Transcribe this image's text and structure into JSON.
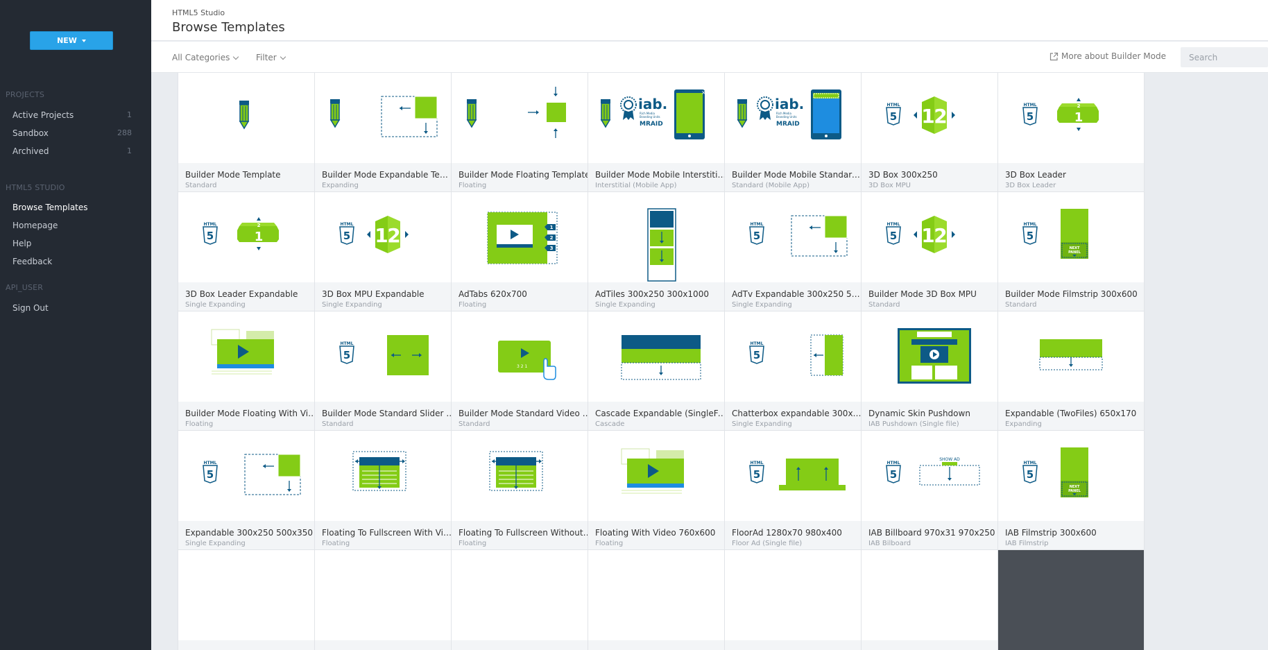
{
  "sidebar": {
    "new_label": "NEW",
    "projects_heading": "PROJECTS",
    "projects": [
      {
        "label": "Active Projects",
        "count": "1"
      },
      {
        "label": "Sandbox",
        "count": "288"
      },
      {
        "label": "Archived",
        "count": "1"
      }
    ],
    "studio_heading": "HTML5 STUDIO",
    "studio_items": [
      "Browse Templates",
      "Homepage",
      "Help",
      "Feedback"
    ],
    "user_heading": "API_USER",
    "sign_out": "Sign Out"
  },
  "header": {
    "breadcrumb": "HTML5 Studio",
    "title": "Browse Templates"
  },
  "filters": {
    "categories": "All Categories",
    "filter": "Filter",
    "more_link": "More about Builder Mode",
    "search_placeholder": "Search"
  },
  "colors": {
    "accent": "#29a3e8",
    "green": "#84cc16",
    "navy": "#0d5a86",
    "sidebar": "#242a33"
  },
  "templates": [
    {
      "title": "Builder Mode Template",
      "subtitle": "Standard",
      "thumb": "pencil"
    },
    {
      "title": "Builder Mode Expandable Templ...",
      "subtitle": "Expanding",
      "thumb": "pencil-expand"
    },
    {
      "title": "Builder Mode Floating Template",
      "subtitle": "Floating",
      "thumb": "pencil-float"
    },
    {
      "title": "Builder Mode Mobile Interstitial...",
      "subtitle": "Interstitial (Mobile App)",
      "thumb": "iab-green",
      "iab": "iab.",
      "mraid": "MRAID"
    },
    {
      "title": "Builder Mode Mobile Standard T...",
      "subtitle": "Standard (Mobile App)",
      "thumb": "iab-blue",
      "iab": "iab.",
      "mraid": "MRAID"
    },
    {
      "title": "3D Box 300x250",
      "subtitle": "3D Box MPU",
      "thumb": "box12"
    },
    {
      "title": "3D Box Leader",
      "subtitle": "3D Box Leader",
      "thumb": "leader"
    },
    {
      "title": "3D Box Leader Expandable",
      "subtitle": "Single Expanding",
      "thumb": "leader"
    },
    {
      "title": "3D Box MPU Expandable",
      "subtitle": "Single Expanding",
      "thumb": "box12"
    },
    {
      "title": "AdTabs 620x700",
      "subtitle": "Floating",
      "thumb": "adtabs"
    },
    {
      "title": "AdTiles 300x250 300x1000",
      "subtitle": "Single Expanding",
      "thumb": "adtiles"
    },
    {
      "title": "AdTv Expandable 300x250 500x...",
      "subtitle": "Single Expanding",
      "thumb": "html5-expand"
    },
    {
      "title": "Builder Mode 3D Box MPU",
      "subtitle": "Standard",
      "thumb": "box12"
    },
    {
      "title": "Builder Mode Filmstrip 300x600",
      "subtitle": "Standard",
      "thumb": "filmstrip",
      "panel": "NEXT PANEL"
    },
    {
      "title": "Builder Mode Floating With Vid...",
      "subtitle": "Floating",
      "thumb": "video-float"
    },
    {
      "title": "Builder Mode Standard Slider 3...",
      "subtitle": "Standard",
      "thumb": "slider"
    },
    {
      "title": "Builder Mode Standard Video M...",
      "subtitle": "Standard",
      "thumb": "video-hand",
      "counter": "3 2 1"
    },
    {
      "title": "Cascade Expandable (SingleFile)...",
      "subtitle": "Cascade",
      "thumb": "cascade"
    },
    {
      "title": "Chatterbox expandable 300x60...",
      "subtitle": "Single Expanding",
      "thumb": "chatterbox"
    },
    {
      "title": "Dynamic Skin Pushdown",
      "subtitle": "IAB Pushdown (Single file)",
      "thumb": "skin"
    },
    {
      "title": "Expandable (TwoFiles) 650x170",
      "subtitle": "Expanding",
      "thumb": "twofiles"
    },
    {
      "title": "Expandable 300x250 500x350",
      "subtitle": "Single Expanding",
      "thumb": "html5-expand"
    },
    {
      "title": "Floating To Fullscreen With Video",
      "subtitle": "Floating",
      "thumb": "fullscreen"
    },
    {
      "title": "Floating To Fullscreen Without ...",
      "subtitle": "Floating",
      "thumb": "fullscreen"
    },
    {
      "title": "Floating With Video 760x600",
      "subtitle": "Floating",
      "thumb": "video-float"
    },
    {
      "title": "FloorAd 1280x70 980x400",
      "subtitle": "Floor Ad (Single file)",
      "thumb": "floorad"
    },
    {
      "title": "IAB Billboard 970x31 970x250",
      "subtitle": "IAB Bilboard",
      "thumb": "billboard",
      "show_ad": "SHOW AD"
    },
    {
      "title": "IAB Filmstrip 300x600",
      "subtitle": "IAB Filmstrip",
      "thumb": "filmstrip",
      "panel": "NEXT PANEL"
    },
    {
      "title": "",
      "subtitle": "",
      "thumb": "blank"
    },
    {
      "title": "",
      "subtitle": "",
      "thumb": "blank"
    },
    {
      "title": "",
      "subtitle": "",
      "thumb": "blank"
    },
    {
      "title": "",
      "subtitle": "",
      "thumb": "blank"
    },
    {
      "title": "",
      "subtitle": "",
      "thumb": "blank"
    },
    {
      "title": "",
      "subtitle": "",
      "thumb": "blank"
    },
    {
      "title": "",
      "subtitle": "",
      "thumb": "dark"
    }
  ]
}
